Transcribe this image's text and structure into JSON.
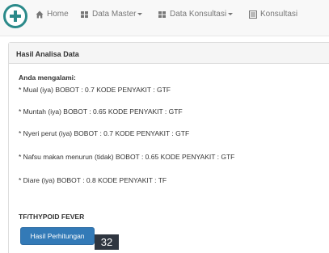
{
  "nav": {
    "home": "Home",
    "data_master": "Data Master",
    "data_konsultasi": "Data Konsultasi",
    "konsultasi": "Konsultasi"
  },
  "panel": {
    "heading": "Hasil Analisa Data",
    "intro": "Anda mengalami:",
    "symptoms": [
      "* Mual (iya) BOBOT : 0.7 KODE PENYAKIT : GTF",
      "* Muntah (iya) BOBOT : 0.65 KODE PENYAKIT : GTF",
      "* Nyeri perut (iya) BOBOT : 0.7 KODE PENYAKIT : GTF",
      "* Nafsu makan menurun (tidak) BOBOT : 0.65 KODE PENYAKIT : GTF",
      "* Diare (iya) BOBOT : 0.8 KODE PENYAKIT : TF"
    ],
    "result": "TF/THYPOID FEVER",
    "button_label": "Hasil Perhitungan"
  },
  "page_badge": "32",
  "colors": {
    "brand": "#2b8a8a",
    "primary_button": "#337ab7",
    "badge_bg": "#2f3640"
  }
}
